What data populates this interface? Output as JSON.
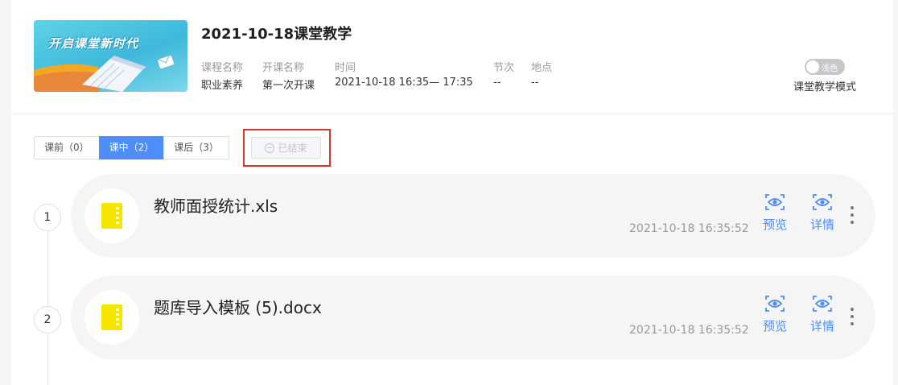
{
  "header": {
    "cover_text": "开启课堂新时代",
    "title": "2021-10-18课堂教学",
    "meta": [
      {
        "label": "课程名称",
        "value": "职业素养"
      },
      {
        "label": "开课名称",
        "value": "第一次开课"
      },
      {
        "label": "时间",
        "value": "2021-10-18 16:35— 17:35"
      },
      {
        "label": "节次",
        "value": "--"
      },
      {
        "label": "地点",
        "value": "--"
      }
    ],
    "mode_toggle_text": "浅色",
    "mode_label": "课堂教学模式"
  },
  "tabs": [
    {
      "label": "课前（0）",
      "active": false
    },
    {
      "label": "课中（2）",
      "active": true
    },
    {
      "label": "课后（3）",
      "active": false
    }
  ],
  "ended_button": "已结束",
  "items": [
    {
      "index": "1",
      "name": "教师面授统计.xls",
      "time": "2021-10-18 16:35:52",
      "preview_label": "预览",
      "detail_label": "详情",
      "icon": "file-icon"
    },
    {
      "index": "2",
      "name": "题库导入模板 (5).docx",
      "time": "2021-10-18 16:35:52",
      "preview_label": "预览",
      "detail_label": "详情",
      "icon": "file-icon"
    }
  ],
  "colors": {
    "accent": "#4d8ef8",
    "highlight_border": "#e0322f",
    "file_icon": "#f5e500"
  }
}
